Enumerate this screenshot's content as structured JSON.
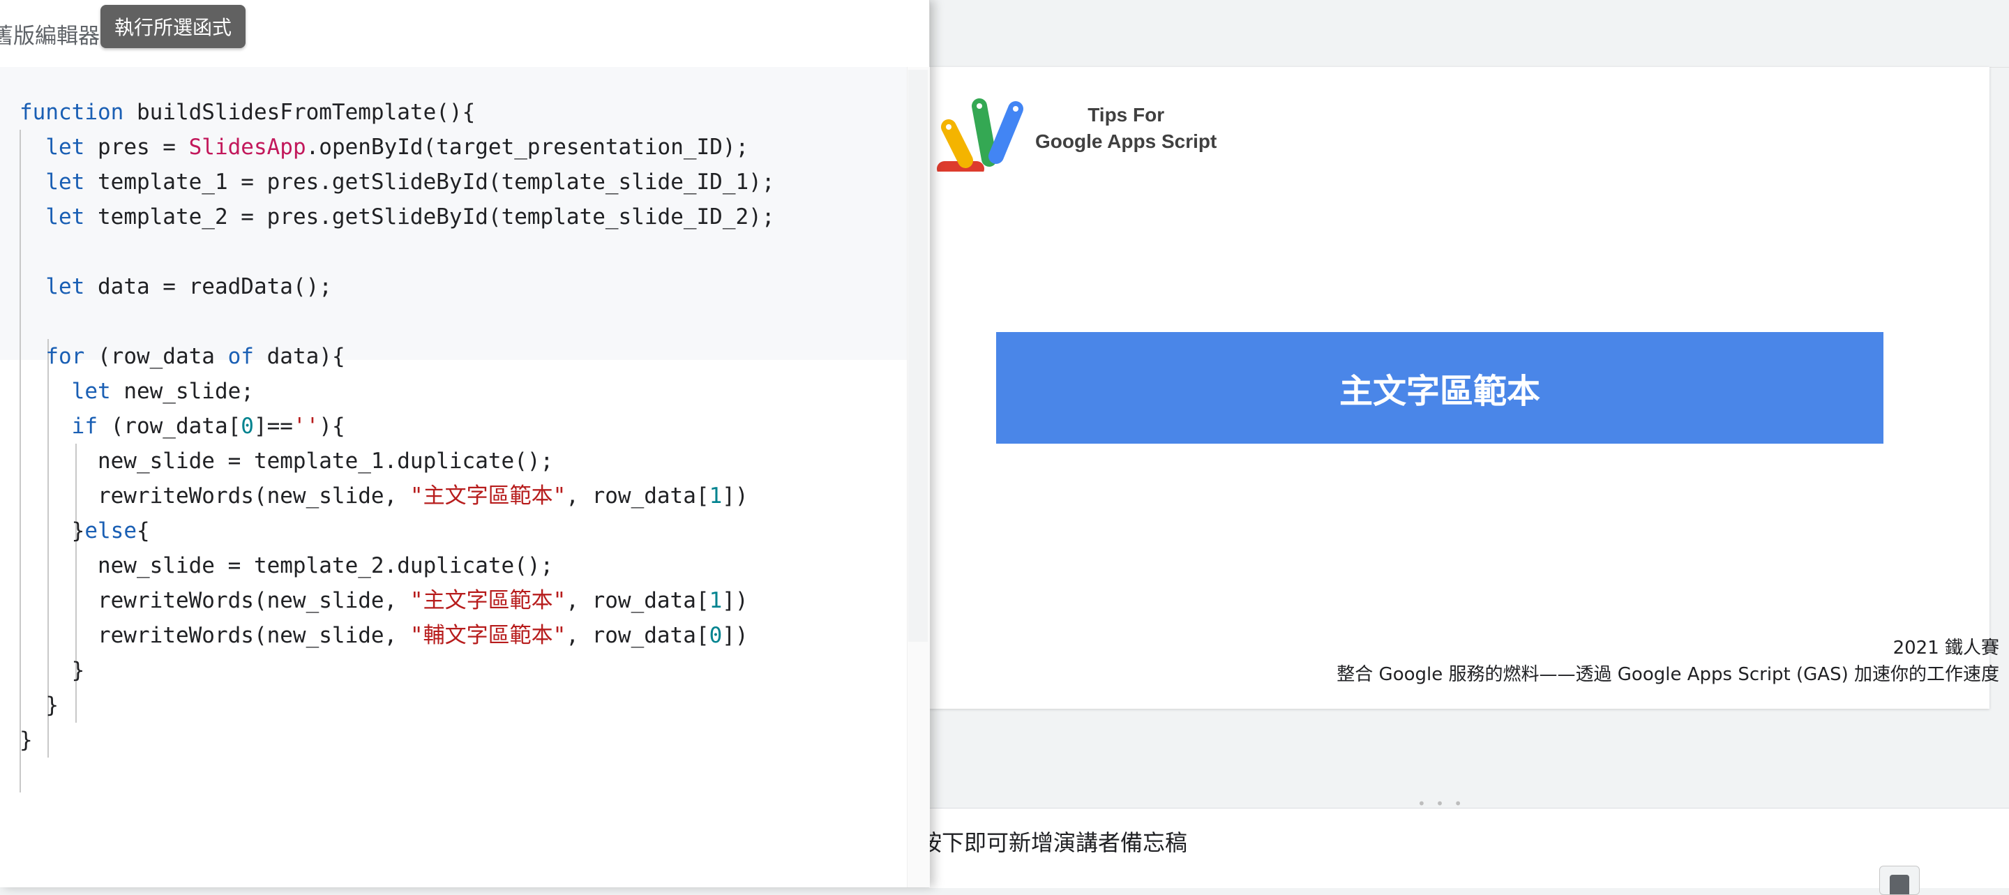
{
  "editor": {
    "header_label": "舊版編輯器",
    "tooltip": "執行所選函式",
    "code_lines": [
      [
        {
          "t": "function",
          "c": "kw"
        },
        {
          "t": " buildSlidesFromTemplate(){",
          "c": ""
        }
      ],
      [
        {
          "t": "  ",
          "c": ""
        },
        {
          "t": "let",
          "c": "kw"
        },
        {
          "t": " pres = ",
          "c": ""
        },
        {
          "t": "SlidesApp",
          "c": "cls"
        },
        {
          "t": ".openById(target_presentation_ID);",
          "c": ""
        }
      ],
      [
        {
          "t": "  ",
          "c": ""
        },
        {
          "t": "let",
          "c": "kw"
        },
        {
          "t": " template_1 = pres.getSlideById(template_slide_ID_1);",
          "c": ""
        }
      ],
      [
        {
          "t": "  ",
          "c": ""
        },
        {
          "t": "let",
          "c": "kw"
        },
        {
          "t": " template_2 = pres.getSlideById(template_slide_ID_2);",
          "c": ""
        }
      ],
      [],
      [
        {
          "t": "  ",
          "c": ""
        },
        {
          "t": "let",
          "c": "kw"
        },
        {
          "t": " data = readData();",
          "c": ""
        }
      ],
      [],
      [
        {
          "t": "  ",
          "c": ""
        },
        {
          "t": "for",
          "c": "kw"
        },
        {
          "t": " (row_data ",
          "c": ""
        },
        {
          "t": "of",
          "c": "kw"
        },
        {
          "t": " data){",
          "c": ""
        }
      ],
      [
        {
          "t": "    ",
          "c": ""
        },
        {
          "t": "let",
          "c": "kw"
        },
        {
          "t": " new_slide;",
          "c": ""
        }
      ],
      [
        {
          "t": "    ",
          "c": ""
        },
        {
          "t": "if",
          "c": "kw"
        },
        {
          "t": " (row_data[",
          "c": ""
        },
        {
          "t": "0",
          "c": "num"
        },
        {
          "t": "]==",
          "c": ""
        },
        {
          "t": "''",
          "c": "str"
        },
        {
          "t": "){",
          "c": ""
        }
      ],
      [
        {
          "t": "      new_slide = template_1.duplicate();",
          "c": ""
        }
      ],
      [
        {
          "t": "      rewriteWords(new_slide, ",
          "c": ""
        },
        {
          "t": "\"主文字區範本\"",
          "c": "str"
        },
        {
          "t": ", row_data[",
          "c": ""
        },
        {
          "t": "1",
          "c": "num"
        },
        {
          "t": "])",
          "c": ""
        }
      ],
      [
        {
          "t": "    }",
          "c": ""
        },
        {
          "t": "else",
          "c": "kw"
        },
        {
          "t": "{",
          "c": ""
        }
      ],
      [
        {
          "t": "      new_slide = template_2.duplicate();",
          "c": ""
        }
      ],
      [
        {
          "t": "      rewriteWords(new_slide, ",
          "c": ""
        },
        {
          "t": "\"主文字區範本\"",
          "c": "str"
        },
        {
          "t": ", row_data[",
          "c": ""
        },
        {
          "t": "1",
          "c": "num"
        },
        {
          "t": "])",
          "c": ""
        }
      ],
      [
        {
          "t": "      rewriteWords(new_slide, ",
          "c": ""
        },
        {
          "t": "\"輔文字區範本\"",
          "c": "str"
        },
        {
          "t": ", row_data[",
          "c": ""
        },
        {
          "t": "0",
          "c": "num"
        },
        {
          "t": "])",
          "c": ""
        }
      ],
      [
        {
          "t": "    }",
          "c": ""
        }
      ],
      [
        {
          "t": "  }",
          "c": ""
        }
      ],
      [
        {
          "t": "}",
          "c": ""
        }
      ]
    ]
  },
  "slide": {
    "logo_line1": "Tips For",
    "logo_line2": "Google Apps Script",
    "title": "主文字區範本",
    "footer_line1": "2021 鐵人賽",
    "footer_line2": "整合 Google 服務的燃料——透過 Google Apps Script (GAS) 加速你的工作速度"
  },
  "notes": {
    "text": "按下即可新增演講者備忘稿"
  },
  "colors": {
    "keyword": "#1a5fb4",
    "class": "#c2185b",
    "string": "#b71c1c",
    "number": "#00838f",
    "title_bar": "#4a86e8"
  },
  "icons": [
    "apps-script-logo",
    "speaker-notes-toggle-icon"
  ]
}
